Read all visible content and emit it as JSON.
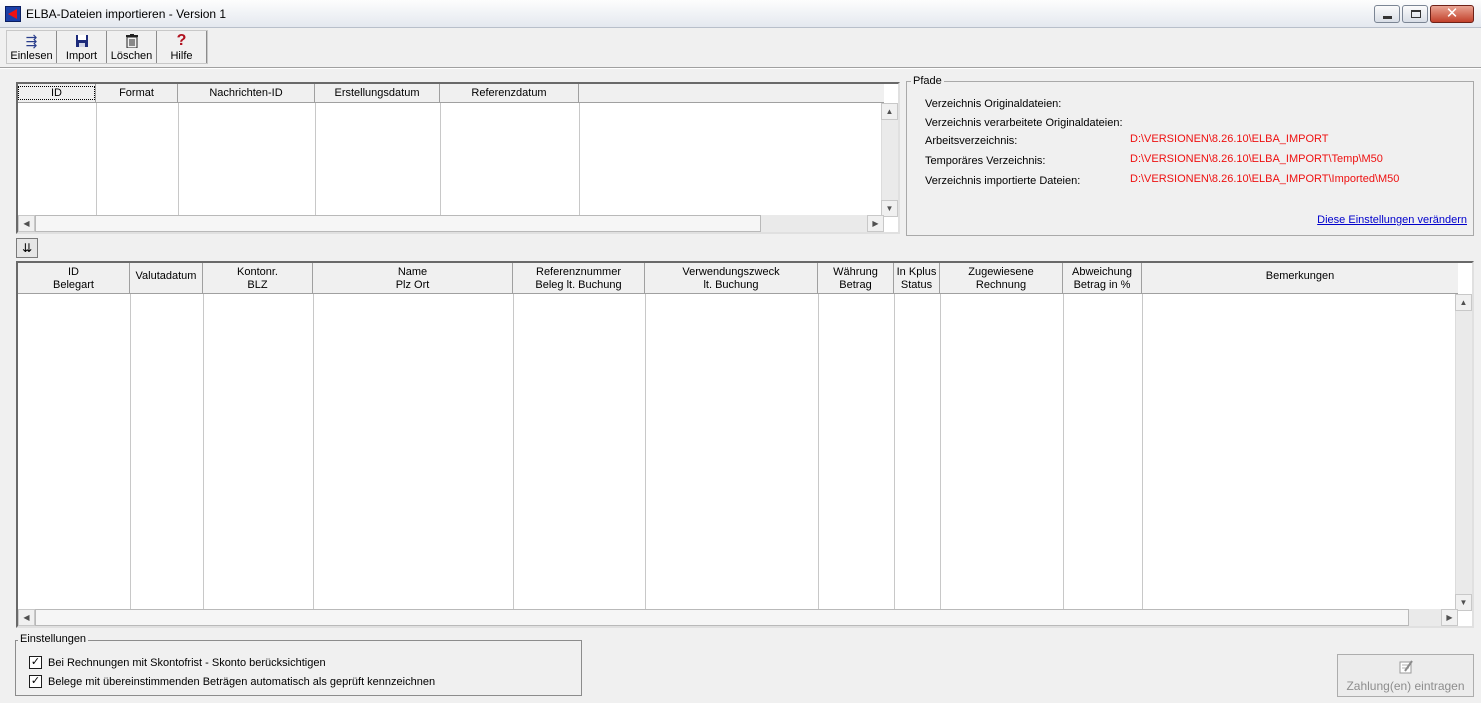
{
  "window": {
    "title": "ELBA-Dateien importieren - Version 1"
  },
  "toolbar": {
    "buttons": [
      {
        "label": "Einlesen",
        "icon": "read-in-icon"
      },
      {
        "label": "Import",
        "icon": "save-disk-icon"
      },
      {
        "label": "Löschen",
        "icon": "trash-icon"
      },
      {
        "label": "Hilfe",
        "icon": "help-question-icon"
      }
    ]
  },
  "grid1": {
    "columns": [
      "ID",
      "Format",
      "Nachrichten-ID",
      "Erstellungsdatum",
      "Referenzdatum"
    ]
  },
  "pfade": {
    "legend": "Pfade",
    "rows": [
      {
        "label": "Verzeichnis Originaldateien:",
        "value": ""
      },
      {
        "label": "Verzeichnis verarbeitete Originaldateien:",
        "value": ""
      },
      {
        "label": "Arbeitsverzeichnis:",
        "value": "D:\\VERSIONEN\\8.26.10\\ELBA_IMPORT"
      },
      {
        "label": "Temporäres Verzeichnis:",
        "value": "D:\\VERSIONEN\\8.26.10\\ELBA_IMPORT\\Temp\\M50"
      },
      {
        "label": "Verzeichnis importierte Dateien:",
        "value": "D:\\VERSIONEN\\8.26.10\\ELBA_IMPORT\\Imported\\M50"
      }
    ],
    "link": "Diese Einstellungen verändern",
    "value_color": "#ee1111"
  },
  "grid2": {
    "columns": [
      {
        "l1": "ID",
        "l2": "Belegart"
      },
      {
        "l1": "Valutadatum",
        "l2": ""
      },
      {
        "l1": "Kontonr.",
        "l2": "BLZ"
      },
      {
        "l1": "Name",
        "l2": "Plz Ort"
      },
      {
        "l1": "Referenznummer",
        "l2": "Beleg lt. Buchung"
      },
      {
        "l1": "Verwendungszweck",
        "l2": "lt. Buchung"
      },
      {
        "l1": "Währung",
        "l2": "Betrag"
      },
      {
        "l1": "In Kplus",
        "l2": "Status"
      },
      {
        "l1": "Zugewiesene",
        "l2": "Rechnung"
      },
      {
        "l1": "Abweichung",
        "l2": "Betrag in %"
      },
      {
        "l1": "Bemerkungen",
        "l2": ""
      }
    ]
  },
  "einstellungen": {
    "legend": "Einstellungen",
    "options": [
      {
        "label": "Bei Rechnungen mit Skontofrist -  Skonto berücksichtigen",
        "checked": true
      },
      {
        "label": "Belege mit übereinstimmenden Beträgen automatisch als geprüft kennzeichnen",
        "checked": true
      }
    ]
  },
  "actions": {
    "zahlung_label": "Zahlung(en) eintragen"
  }
}
